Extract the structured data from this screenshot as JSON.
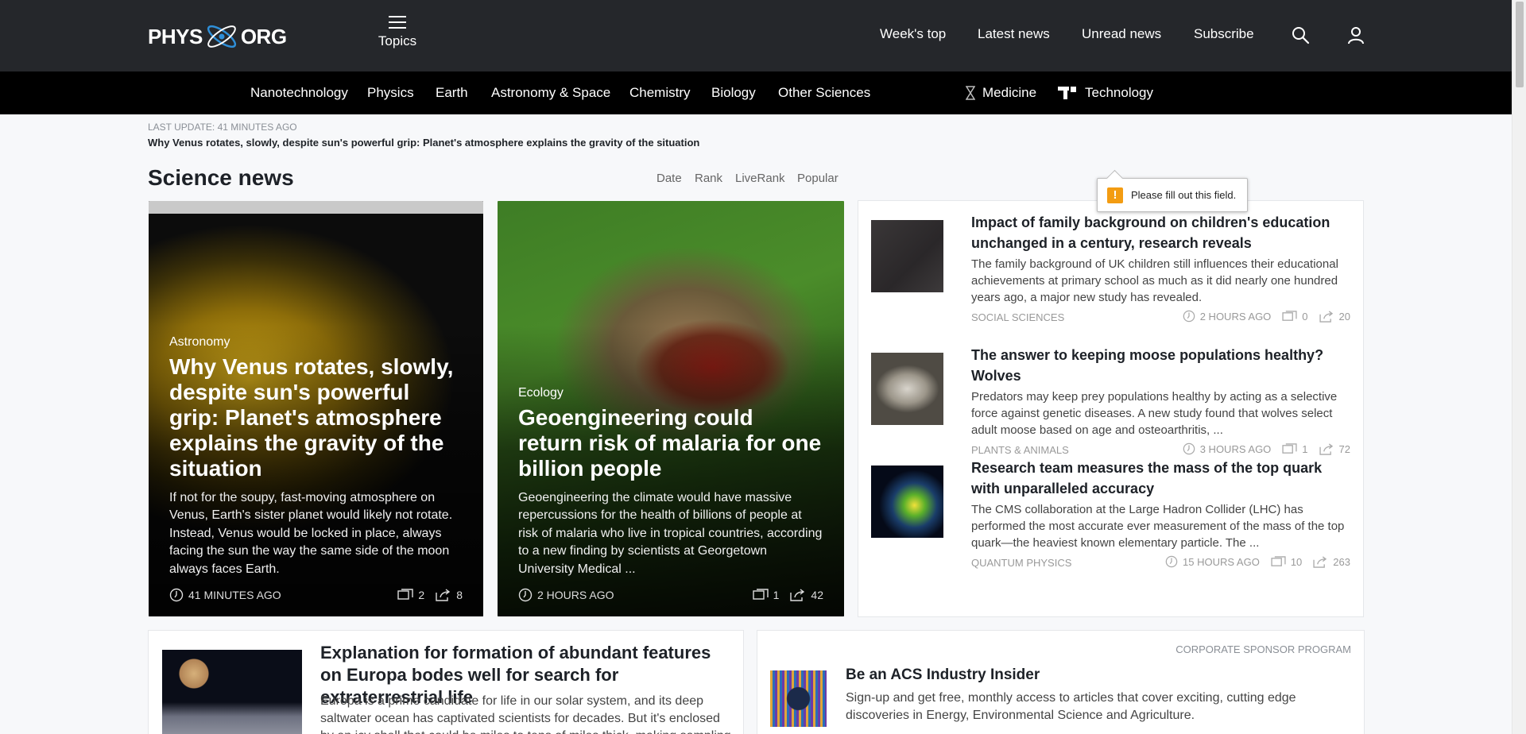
{
  "header": {
    "logo_left": "PHYS",
    "logo_right": "ORG",
    "topics_label": "Topics",
    "nav": [
      "Week's top",
      "Latest news",
      "Unread news",
      "Subscribe"
    ]
  },
  "categories": [
    "Nanotechnology",
    "Physics",
    "Earth",
    "Astronomy & Space",
    "Chemistry",
    "Biology",
    "Other Sciences",
    "Medicine",
    "Technology"
  ],
  "update": {
    "label": "LAST UPDATE: 41 minutes ago",
    "headline": "Why Venus rotates, slowly, despite sun's powerful grip: Planet's atmosphere explains the gravity of the situation"
  },
  "section": {
    "title": "Science news",
    "sort": [
      "Date",
      "Rank",
      "LiveRank",
      "Popular"
    ]
  },
  "tooltip": {
    "text": "Please fill out this field.",
    "icon": "!"
  },
  "features": [
    {
      "category": "Astronomy",
      "title": "Why Venus rotates, slowly, despite sun's powerful grip: Planet's atmosphere explains the gravity of the situation",
      "desc": "If not for the soupy, fast-moving atmosphere on Venus, Earth's sister planet would likely not rotate. Instead, Venus would be locked in place, always facing the sun the way the same side of the moon always faces Earth.",
      "time": "41 MINUTES AGO",
      "comments": "2",
      "shares": "8"
    },
    {
      "category": "Ecology",
      "title": "Geoengineering could return risk of malaria for one billion people",
      "desc": "Geoengineering the climate would have massive repercussions for the health of billions of people at risk of malaria who live in tropical countries, according to a new finding by scientists at Georgetown University Medical ...",
      "time": "2 HOURS AGO",
      "comments": "1",
      "shares": "42"
    }
  ],
  "list": [
    {
      "title": "Impact of family background on children's education unchanged in a century, research reveals",
      "desc": "The family background of UK children still influences their educational achievements at primary school as much as it did nearly one hundred years ago, a major new study has revealed.",
      "category": "SOCIAL SCIENCES",
      "time": "2 HOURS AGO",
      "comments": "0",
      "shares": "20"
    },
    {
      "title": "The answer to keeping moose populations healthy? Wolves",
      "desc": "Predators may keep prey populations healthy by acting as a selective force against genetic diseases. A new study found that wolves select adult moose based on age and osteoarthritis, ...",
      "category": "PLANTS & ANIMALS",
      "time": "3 HOURS AGO",
      "comments": "1",
      "shares": "72"
    },
    {
      "title": "Research team measures the mass of the top quark with unparalleled accuracy",
      "desc": "The CMS collaboration at the Large Hadron Collider (LHC) has performed the most accurate ever measurement of the mass of the top quark—the heaviest known elementary particle. The ...",
      "category": "QUANTUM PHYSICS",
      "time": "15 HOURS AGO",
      "comments": "10",
      "shares": "263"
    }
  ],
  "bottom": {
    "europa": {
      "title": "Explanation for formation of abundant features on Europa bodes well for search for extraterrestrial life",
      "desc": "Europa is a prime candidate for life in our solar system, and its deep saltwater ocean has captivated scientists for decades. But it's enclosed by an icy shell that could be miles to tens of miles thick, making sampling"
    },
    "sponsor": {
      "label": "CORPORATE SPONSOR PROGRAM",
      "title": "Be an ACS Industry Insider",
      "desc": "Sign-up and get free, monthly access to articles that cover exciting, cutting edge discoveries in Energy, Environmental Science and Agriculture."
    }
  },
  "colors": {
    "header_bg": "#25272b",
    "catbar_bg": "#000000",
    "warn": "#f39c12"
  }
}
